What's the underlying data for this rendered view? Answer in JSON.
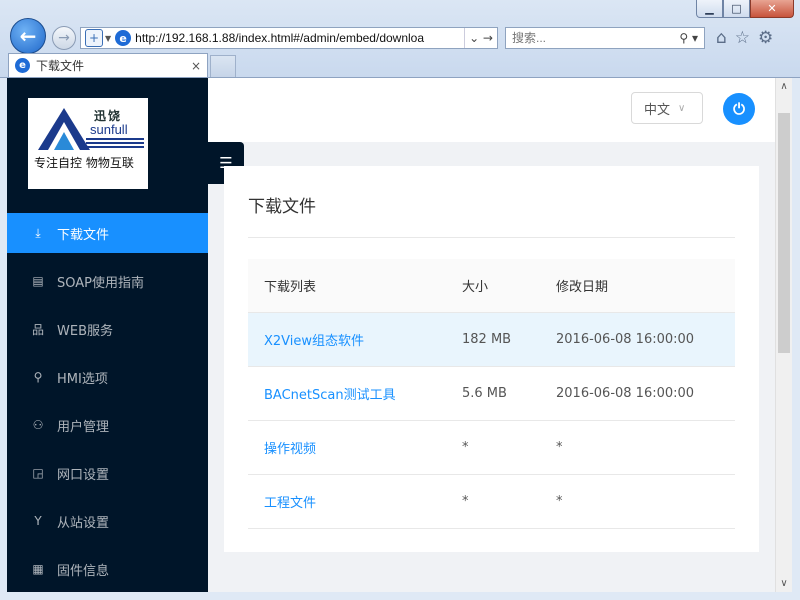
{
  "browser": {
    "url": "http://192.168.1.88/index.html#/admin/embed/downloa",
    "search_placeholder": "搜索...",
    "tab_title": "下载文件",
    "tab_close": "×",
    "window_buttons": {
      "minimize": "▁",
      "maximize": "□",
      "close": "✕"
    }
  },
  "logo": {
    "cn_name": "迅饶",
    "en_name": "sunfull",
    "slogan": "专注自控  物物互联"
  },
  "menu": [
    {
      "label": "下载文件",
      "icon": "download-icon",
      "glyph": "⤓",
      "active": true
    },
    {
      "label": "SOAP使用指南",
      "icon": "document-icon",
      "glyph": "▤",
      "active": false
    },
    {
      "label": "WEB服务",
      "icon": "cluster-icon",
      "glyph": "品",
      "active": false
    },
    {
      "label": "HMI选项",
      "icon": "rocket-icon",
      "glyph": "⚲",
      "active": false
    },
    {
      "label": "用户管理",
      "icon": "user-icon",
      "glyph": "⚇",
      "active": false
    },
    {
      "label": "网口设置",
      "icon": "port-icon",
      "glyph": "◲",
      "active": false
    },
    {
      "label": "从站设置",
      "icon": "fork-icon",
      "glyph": "Y",
      "active": false
    },
    {
      "label": "固件信息",
      "icon": "file-icon",
      "glyph": "▦",
      "active": false
    }
  ],
  "header": {
    "language": "中文",
    "logout_icon": "logout-icon"
  },
  "card": {
    "title": "下载文件",
    "columns": [
      "下载列表",
      "大小",
      "修改日期"
    ],
    "rows": [
      {
        "name": "X2View组态软件",
        "size": "182 MB",
        "date": "2016-06-08 16:00:00"
      },
      {
        "name": "BACnetScan测试工具",
        "size": "5.6 MB",
        "date": "2016-06-08 16:00:00"
      },
      {
        "name": "操作视频",
        "size": "*",
        "date": "*"
      },
      {
        "name": "工程文件",
        "size": "*",
        "date": "*"
      }
    ]
  },
  "colors": {
    "sidebar_bg": "#001529",
    "accent": "#1890ff",
    "row_highlight": "#e9f5fd"
  }
}
